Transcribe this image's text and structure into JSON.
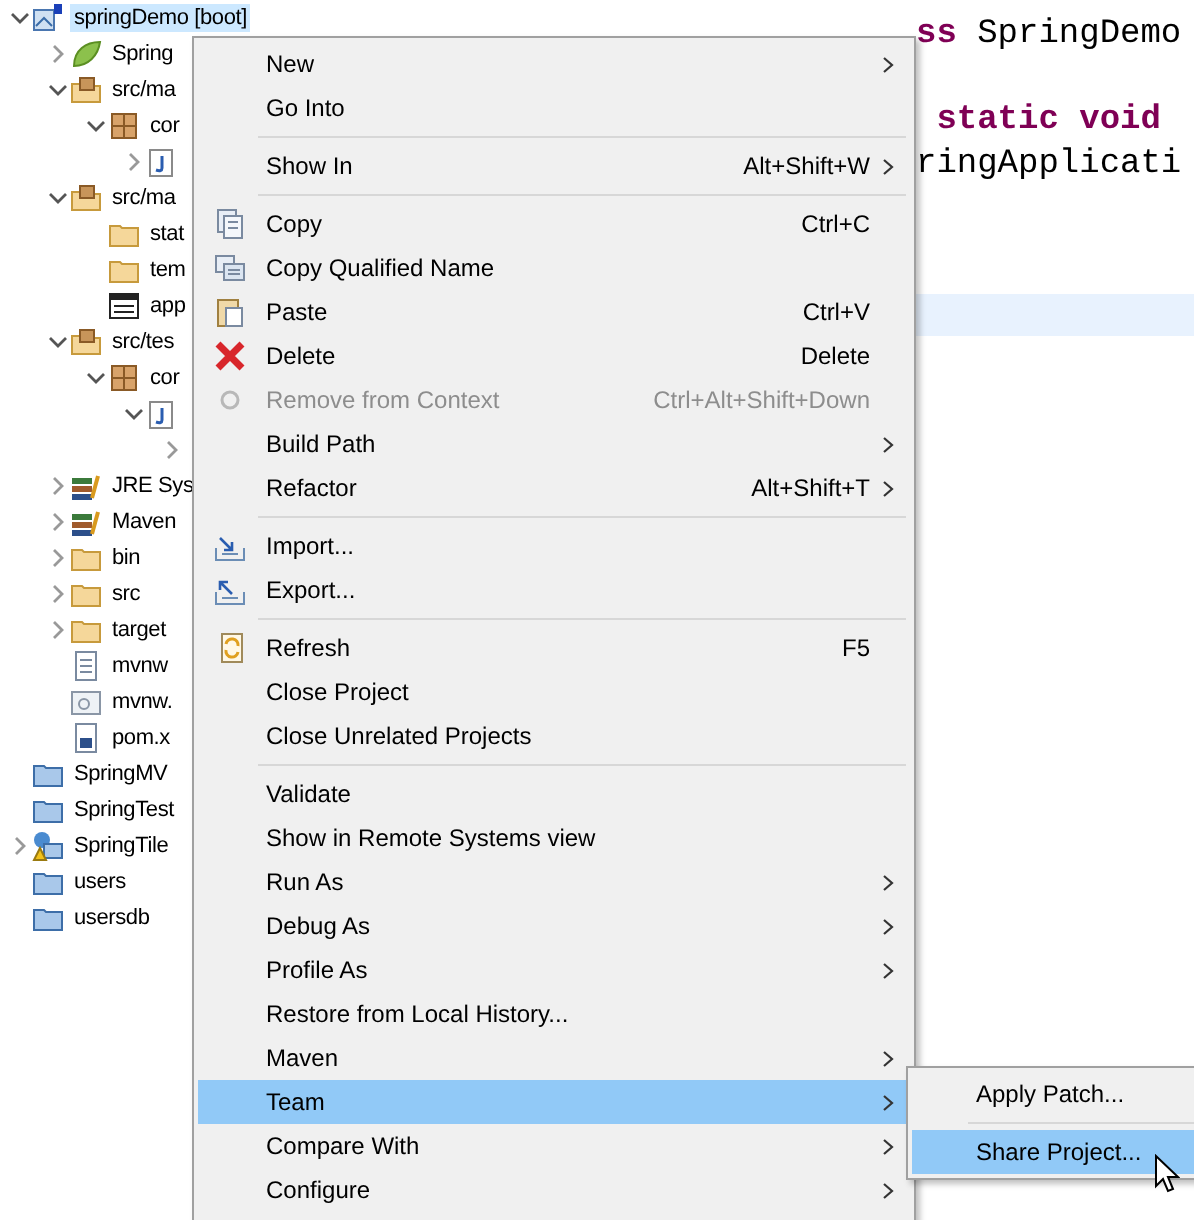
{
  "tree": [
    {
      "label": "springDemo [boot]",
      "kind": "project",
      "expanded": true,
      "selected": true,
      "children": [
        {
          "label": "Spring",
          "kind": "spring",
          "expanded": false,
          "selected": false
        },
        {
          "label": "src/ma",
          "kind": "srcfolder",
          "expanded": true,
          "selected": false,
          "children": [
            {
              "label": "cor",
              "kind": "package",
              "expanded": true,
              "selected": false,
              "children": [
                {
                  "kind": "java",
                  "expanded": false
                }
              ]
            }
          ]
        },
        {
          "label": "src/ma",
          "kind": "srcfolder",
          "expanded": true,
          "selected": false,
          "children": [
            {
              "label": "stat",
              "kind": "folder",
              "selected": false
            },
            {
              "label": "tem",
              "kind": "folder",
              "selected": false
            },
            {
              "label": "app",
              "kind": "props",
              "selected": false
            }
          ]
        },
        {
          "label": "src/tes",
          "kind": "srcfolder",
          "expanded": true,
          "selected": false,
          "children": [
            {
              "label": "cor",
              "kind": "package",
              "expanded": true,
              "selected": false,
              "children": [
                {
                  "kind": "java",
                  "expanded": true,
                  "children": [
                    {
                      "expanded": false
                    }
                  ]
                }
              ]
            }
          ]
        },
        {
          "label": "JRE Sys",
          "kind": "library",
          "expanded": false,
          "selected": false
        },
        {
          "label": "Maven",
          "kind": "library",
          "expanded": false,
          "selected": false
        },
        {
          "label": "bin",
          "kind": "folder",
          "expanded": false,
          "selected": false
        },
        {
          "label": "src",
          "kind": "folder",
          "expanded": false,
          "selected": false
        },
        {
          "label": "target",
          "kind": "folder",
          "expanded": false,
          "selected": false
        },
        {
          "label": "mvnw",
          "kind": "file",
          "selected": false
        },
        {
          "label": "mvnw.",
          "kind": "cmd",
          "selected": false
        },
        {
          "label": "pom.x",
          "kind": "pom",
          "selected": false
        }
      ]
    },
    {
      "label": "SpringMV",
      "kind": "closed",
      "selected": false
    },
    {
      "label": "SpringTest",
      "kind": "closed",
      "selected": false
    },
    {
      "label": "SpringTile",
      "kind": "warnproject",
      "expanded": false,
      "selected": false
    },
    {
      "label": "users",
      "kind": "closed",
      "selected": false
    },
    {
      "label": "usersdb",
      "kind": "closed",
      "selected": false
    }
  ],
  "editor": {
    "lines": [
      {
        "segments": [
          {
            "text": "ss",
            "kind": "keyword"
          },
          {
            "text": " SpringDemo",
            "kind": "plain"
          }
        ]
      },
      {
        "segments": [
          {
            "text": " static void",
            "kind": "keyword"
          }
        ]
      },
      {
        "segments": [
          {
            "text": "ringApplicati",
            "kind": "plain"
          }
        ]
      }
    ],
    "current_line_highlight": true
  },
  "menu": [
    {
      "kind": "item",
      "label": "New",
      "submenu": true,
      "disabled": false,
      "selected": false
    },
    {
      "kind": "item",
      "label": "Go Into",
      "submenu": false,
      "disabled": false,
      "selected": false
    },
    {
      "kind": "separator"
    },
    {
      "kind": "item",
      "label": "Show In",
      "shortcut": "Alt+Shift+W",
      "submenu": true,
      "disabled": false,
      "selected": false
    },
    {
      "kind": "separator"
    },
    {
      "kind": "copy",
      "label": "Copy",
      "shortcut": "Ctrl+C",
      "submenu": false,
      "disabled": false,
      "selected": false
    },
    {
      "kind": "copyname",
      "label": "Copy Qualified Name",
      "submenu": false,
      "disabled": false,
      "selected": false
    },
    {
      "kind": "paste",
      "label": "Paste",
      "shortcut": "Ctrl+V",
      "submenu": false,
      "disabled": false,
      "selected": false
    },
    {
      "kind": "delete",
      "label": "Delete",
      "shortcut": "Delete",
      "submenu": false,
      "disabled": false,
      "selected": false
    },
    {
      "kind": "remove",
      "label": "Remove from Context",
      "shortcut": "Ctrl+Alt+Shift+Down",
      "submenu": false,
      "disabled": true,
      "selected": false
    },
    {
      "kind": "item",
      "label": "Build Path",
      "submenu": true,
      "disabled": false,
      "selected": false
    },
    {
      "kind": "item",
      "label": "Refactor",
      "shortcut": "Alt+Shift+T",
      "submenu": true,
      "disabled": false,
      "selected": false
    },
    {
      "kind": "separator"
    },
    {
      "kind": "import",
      "label": "Import...",
      "submenu": false,
      "disabled": false,
      "selected": false
    },
    {
      "kind": "export",
      "label": "Export...",
      "submenu": false,
      "disabled": false,
      "selected": false
    },
    {
      "kind": "separator"
    },
    {
      "kind": "refresh",
      "label": "Refresh",
      "shortcut": "F5",
      "submenu": false,
      "disabled": false,
      "selected": false
    },
    {
      "kind": "item",
      "label": "Close Project",
      "submenu": false,
      "disabled": false,
      "selected": false
    },
    {
      "kind": "item",
      "label": "Close Unrelated Projects",
      "submenu": false,
      "disabled": false,
      "selected": false
    },
    {
      "kind": "separator"
    },
    {
      "kind": "item",
      "label": "Validate",
      "submenu": false,
      "disabled": false,
      "selected": false
    },
    {
      "kind": "item",
      "label": "Show in Remote Systems view",
      "submenu": false,
      "disabled": false,
      "selected": false
    },
    {
      "kind": "item",
      "label": "Run As",
      "submenu": true,
      "disabled": false,
      "selected": false
    },
    {
      "kind": "item",
      "label": "Debug As",
      "submenu": true,
      "disabled": false,
      "selected": false
    },
    {
      "kind": "item",
      "label": "Profile As",
      "submenu": true,
      "disabled": false,
      "selected": false
    },
    {
      "kind": "item",
      "label": "Restore from Local History...",
      "submenu": false,
      "disabled": false,
      "selected": false
    },
    {
      "kind": "item",
      "label": "Maven",
      "submenu": true,
      "disabled": false,
      "selected": false
    },
    {
      "kind": "item",
      "label": "Team",
      "submenu": true,
      "disabled": false,
      "selected": true
    },
    {
      "kind": "item",
      "label": "Compare With",
      "submenu": true,
      "disabled": false,
      "selected": false
    },
    {
      "kind": "item",
      "label": "Configure",
      "submenu": true,
      "disabled": false,
      "selected": false
    }
  ],
  "team_submenu": [
    {
      "kind": "item",
      "label": "Apply Patch...",
      "selected": false
    },
    {
      "kind": "separator"
    },
    {
      "kind": "item",
      "label": "Share Project...",
      "selected": true
    }
  ]
}
